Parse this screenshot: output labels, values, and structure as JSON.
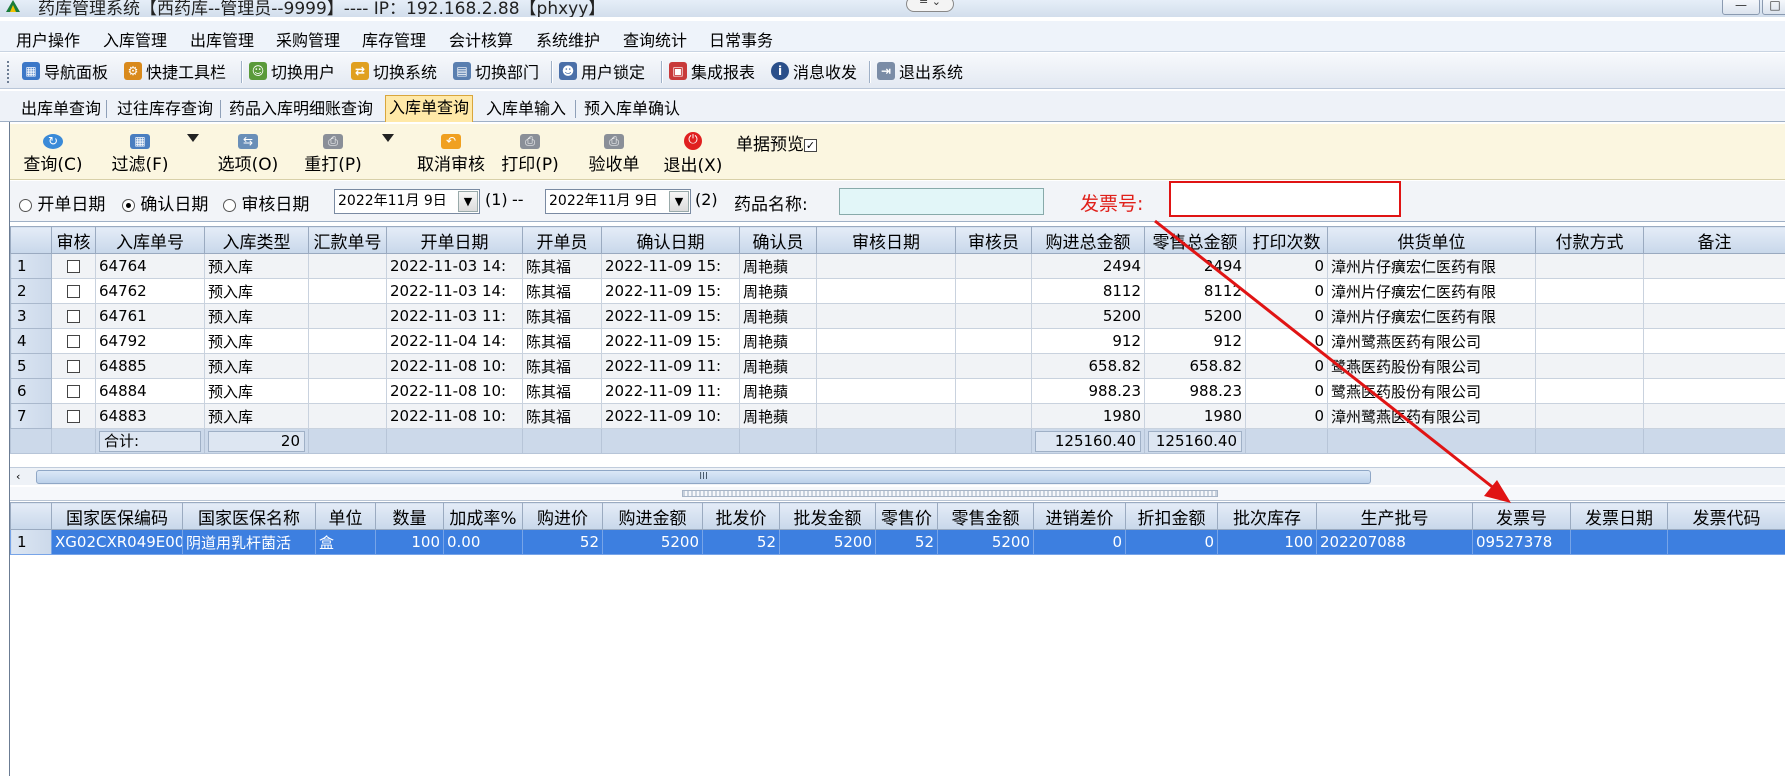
{
  "window": {
    "title": "药库管理系统【西药库--管理员--9999】---- IP：192.168.2.88【phxyy】",
    "center_control": "= ⌄",
    "minimize": "—",
    "maximize": "□"
  },
  "menu": [
    "用户操作",
    "入库管理",
    "出库管理",
    "采购管理",
    "库存管理",
    "会计核算",
    "系统维护",
    "查询统计",
    "日常事务"
  ],
  "toolbar": [
    {
      "label": "导航面板",
      "icon": "navigation-panel-icon"
    },
    {
      "label": "快捷工具栏",
      "icon": "quick-toolbar-icon"
    },
    {
      "label": "切换用户",
      "icon": "switch-user-icon"
    },
    {
      "label": "切换系统",
      "icon": "switch-system-icon"
    },
    {
      "label": "切换部门",
      "icon": "switch-department-icon"
    },
    {
      "label": "用户锁定",
      "icon": "user-lock-icon"
    },
    {
      "label": "集成报表",
      "icon": "report-icon"
    },
    {
      "label": "消息收发",
      "icon": "message-icon"
    },
    {
      "label": "退出系统",
      "icon": "exit-icon"
    }
  ],
  "tabs": [
    "出库单查询",
    "过往库存查询",
    "药品入库明细账查询",
    "入库单查询",
    "入库单输入",
    "预入库单确认"
  ],
  "active_tab": "入库单查询",
  "actions": [
    {
      "label": "查询(C)",
      "icon": "refresh-query-icon"
    },
    {
      "label": "过滤(F)",
      "icon": "filter-icon"
    },
    {
      "label": "选项(O)",
      "icon": "options-icon"
    },
    {
      "label": "重打(P)",
      "icon": "reprint-icon"
    },
    {
      "label": "取消审核",
      "icon": "undo-icon"
    },
    {
      "label": "打印(P)",
      "icon": "printer-icon"
    },
    {
      "label": "验收单",
      "icon": "receipt-print-icon"
    },
    {
      "label": "退出(X)",
      "icon": "power-icon"
    }
  ],
  "preview": {
    "label": "单据预览",
    "checked": true
  },
  "filter": {
    "date_types": [
      {
        "label": "开单日期",
        "selected": false
      },
      {
        "label": "确认日期",
        "selected": true
      },
      {
        "label": "审核日期",
        "selected": false
      }
    ],
    "start_date": "2022年11月 9日",
    "start_hint": "(1)",
    "dash": "--",
    "end_date": "2022年11月 9日",
    "end_hint": "(2)",
    "drug_name_label": "药品名称:",
    "drug_name_value": "",
    "invoice_label": "发票号:",
    "invoice_value": ""
  },
  "master_grid": {
    "columns": [
      "审核",
      "入库单号",
      "入库类型",
      "汇款单号",
      "开单日期",
      "开单员",
      "确认日期",
      "确认员",
      "审核日期",
      "审核员",
      "购进总金额",
      "零售总金额",
      "打印次数",
      "供货单位",
      "付款方式",
      "备注"
    ],
    "rows": [
      {
        "n": "1",
        "audit": false,
        "no": "64764",
        "type": "预入库",
        "remit": "",
        "open_date": "2022-11-03 14:",
        "opener": "陈其福",
        "confirm_date": "2022-11-09 15:",
        "confirmer": "周艳蘋",
        "audit_date": "",
        "auditor": "",
        "purchase_total": "2494",
        "retail_total": "2494",
        "prints": "0",
        "supplier": "漳州片仔癀宏仁医药有限",
        "pay": "",
        "remark": ""
      },
      {
        "n": "2",
        "audit": false,
        "no": "64762",
        "type": "预入库",
        "remit": "",
        "open_date": "2022-11-03 14:",
        "opener": "陈其福",
        "confirm_date": "2022-11-09 15:",
        "confirmer": "周艳蘋",
        "audit_date": "",
        "auditor": "",
        "purchase_total": "8112",
        "retail_total": "8112",
        "prints": "0",
        "supplier": "漳州片仔癀宏仁医药有限",
        "pay": "",
        "remark": ""
      },
      {
        "n": "3",
        "audit": false,
        "no": "64761",
        "type": "预入库",
        "remit": "",
        "open_date": "2022-11-03 11:",
        "opener": "陈其福",
        "confirm_date": "2022-11-09 15:",
        "confirmer": "周艳蘋",
        "audit_date": "",
        "auditor": "",
        "purchase_total": "5200",
        "retail_total": "5200",
        "prints": "0",
        "supplier": "漳州片仔癀宏仁医药有限",
        "pay": "",
        "remark": ""
      },
      {
        "n": "4",
        "audit": false,
        "no": "64792",
        "type": "预入库",
        "remit": "",
        "open_date": "2022-11-04 14:",
        "opener": "陈其福",
        "confirm_date": "2022-11-09 15:",
        "confirmer": "周艳蘋",
        "audit_date": "",
        "auditor": "",
        "purchase_total": "912",
        "retail_total": "912",
        "prints": "0",
        "supplier": "漳州鹭燕医药有限公司",
        "pay": "",
        "remark": ""
      },
      {
        "n": "5",
        "audit": false,
        "no": "64885",
        "type": "预入库",
        "remit": "",
        "open_date": "2022-11-08 10:",
        "opener": "陈其福",
        "confirm_date": "2022-11-09 11:",
        "confirmer": "周艳蘋",
        "audit_date": "",
        "auditor": "",
        "purchase_total": "658.82",
        "retail_total": "658.82",
        "prints": "0",
        "supplier": "鹭燕医药股份有限公司",
        "pay": "",
        "remark": ""
      },
      {
        "n": "6",
        "audit": false,
        "no": "64884",
        "type": "预入库",
        "remit": "",
        "open_date": "2022-11-08 10:",
        "opener": "陈其福",
        "confirm_date": "2022-11-09 11:",
        "confirmer": "周艳蘋",
        "audit_date": "",
        "auditor": "",
        "purchase_total": "988.23",
        "retail_total": "988.23",
        "prints": "0",
        "supplier": "鹭燕医药股份有限公司",
        "pay": "",
        "remark": ""
      },
      {
        "n": "7",
        "audit": false,
        "no": "64883",
        "type": "预入库",
        "remit": "",
        "open_date": "2022-11-08 10:",
        "opener": "陈其福",
        "confirm_date": "2022-11-09 10:",
        "confirmer": "周艳蘋",
        "audit_date": "",
        "auditor": "",
        "purchase_total": "1980",
        "retail_total": "1980",
        "prints": "0",
        "supplier": "漳州鹭燕医药有限公司",
        "pay": "",
        "remark": ""
      }
    ],
    "total": {
      "label": "合计:",
      "count": "20",
      "purchase_total": "125160.40",
      "retail_total": "125160.40"
    }
  },
  "scroll": {
    "thumb_glyph": "III",
    "left_arrow": "‹"
  },
  "detail_grid": {
    "columns": [
      "国家医保编码",
      "国家医保名称",
      "单位",
      "数量",
      "加成率%",
      "购进价",
      "购进金额",
      "批发价",
      "批发金额",
      "零售价",
      "零售金额",
      "进销差价",
      "折扣金额",
      "批次库存",
      "生产批号",
      "发票号",
      "发票日期",
      "发票代码"
    ],
    "rows": [
      {
        "n": "1",
        "code": "XG02CXR049E00(",
        "name": "阴道用乳杆菌活",
        "unit": "盒",
        "qty": "100",
        "markup": "0.00",
        "buy_price": "52",
        "buy_amount": "5200",
        "whole_price": "52",
        "whole_amount": "5200",
        "retail_price": "52",
        "retail_amount": "5200",
        "margin": "0",
        "discount": "0",
        "batch_stock": "100",
        "lot": "202207088",
        "invoice": "09527378",
        "inv_date": "",
        "inv_code": ""
      }
    ]
  },
  "colors": {
    "annotation_red": "#e01414",
    "selected_row": "#3d7fe0",
    "action_bar": "#fbf6e0",
    "tab_active": "#ffe9a8"
  }
}
